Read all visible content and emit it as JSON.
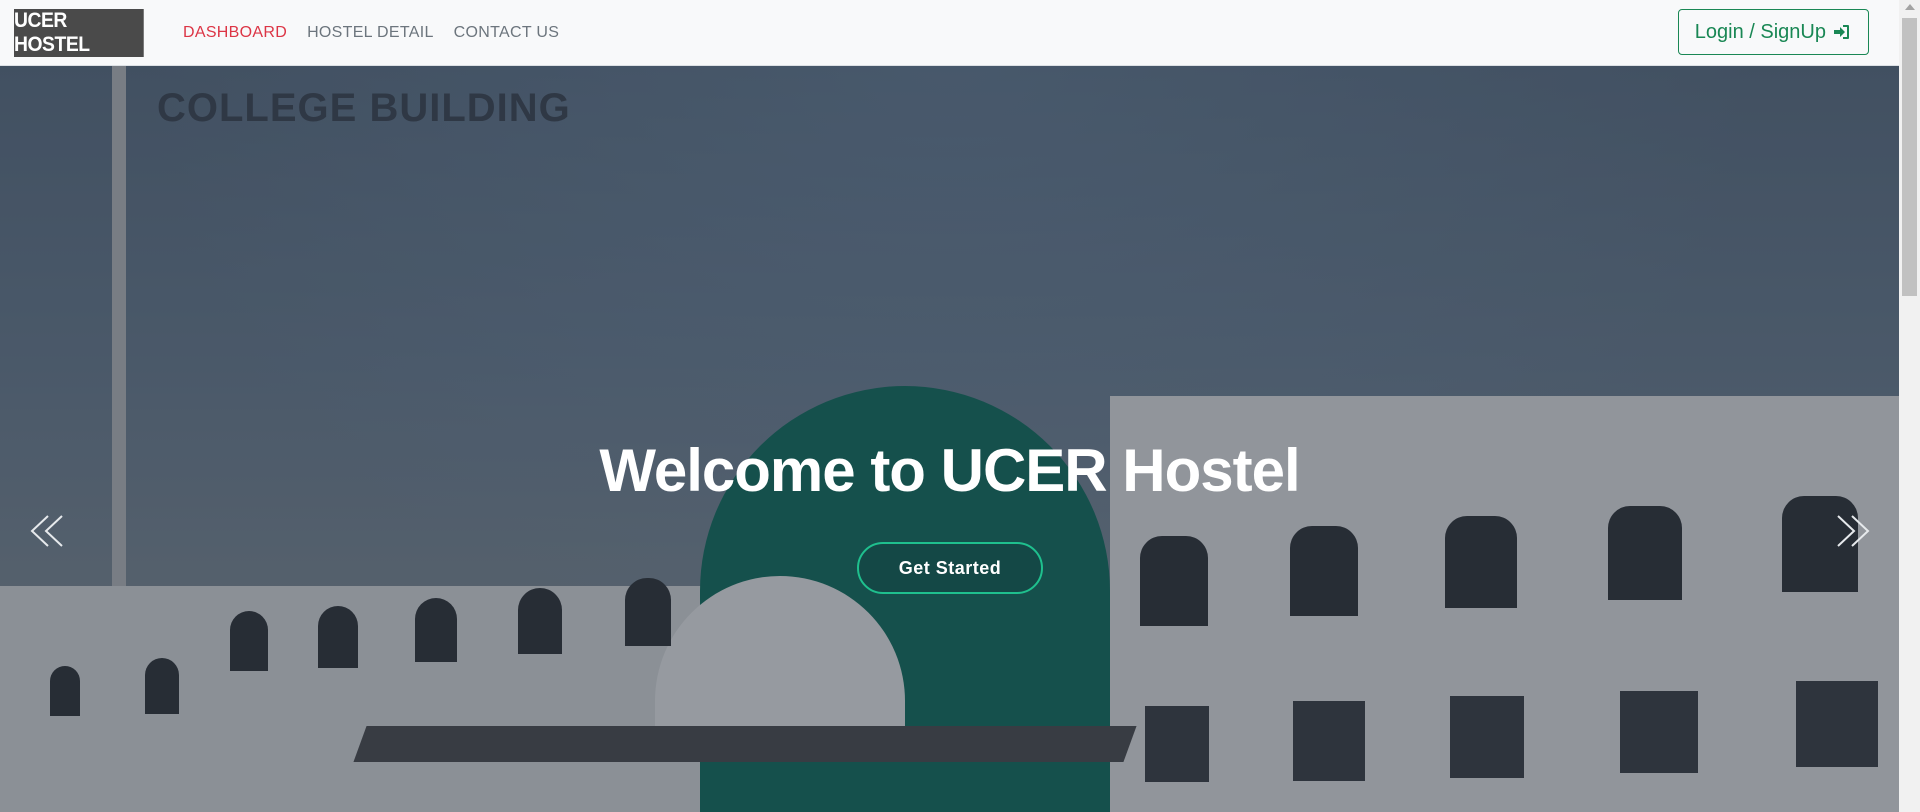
{
  "navbar": {
    "brand": "UCER HOSTEL",
    "links": [
      {
        "label": "DASHBOARD",
        "active": true
      },
      {
        "label": "HOSTEL DETAIL",
        "active": false
      },
      {
        "label": "CONTACT US",
        "active": false
      }
    ],
    "login_label": "Login / SignUp",
    "login_icon": "sign-in-icon"
  },
  "hero": {
    "background_signage": "COLLEGE BUILDING",
    "title": "Welcome to UCER Hostel",
    "cta_label": "Get Started",
    "prev_icon": "double-chevron-left-icon",
    "next_icon": "double-chevron-right-icon"
  },
  "colors": {
    "navbar_bg": "#f8f9fa",
    "active_link": "#dc3545",
    "inactive_link": "#6c757d",
    "login_green": "#198754",
    "cta_border": "#1fc08e",
    "brand_bg": "#4a4a4a"
  }
}
